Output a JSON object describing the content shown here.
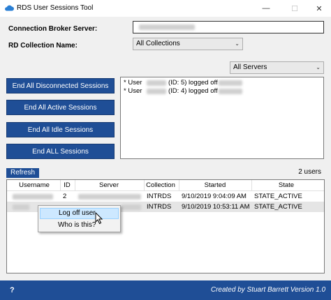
{
  "window": {
    "title": "RDS User Sessions Tool",
    "minimize_glyph": "—",
    "maximize_glyph": "☐",
    "close_glyph": "✕"
  },
  "form": {
    "broker_label": "Connection Broker Server:",
    "collection_label": "RD Collection Name:",
    "collection_value": "All Collections",
    "servers_value": "All Servers"
  },
  "actions": {
    "end_disconnected": "End All Disconnected Sessions",
    "end_active": "End All Active Sessions",
    "end_idle": "End All Idle Sessions",
    "end_all": "End ALL Sessions"
  },
  "log": [
    {
      "prefix": "* User",
      "id_text": "(ID: 5) logged off"
    },
    {
      "prefix": "* User",
      "id_text": "(ID: 4) logged off"
    }
  ],
  "sessions": {
    "refresh_label": "Refresh",
    "count_label": "2 users",
    "columns": [
      "Username",
      "ID",
      "Server",
      "Collection",
      "Started",
      "State"
    ],
    "rows": [
      {
        "id": "2",
        "collection": "INTRDS",
        "started": "9/10/2019 9:04:09 AM",
        "state": "STATE_ACTIVE"
      },
      {
        "id": "",
        "collection": "INTRDS",
        "started": "9/10/2019 10:53:11 AM",
        "state": "STATE_ACTIVE"
      }
    ]
  },
  "context_menu": {
    "items": [
      "Log off user",
      "Who is this?"
    ]
  },
  "footer": {
    "help": "?",
    "credits": "Created by Stuart Barrett   Version 1.0"
  },
  "colors": {
    "accent": "#1f4e96",
    "highlight": "#cde8ff"
  }
}
